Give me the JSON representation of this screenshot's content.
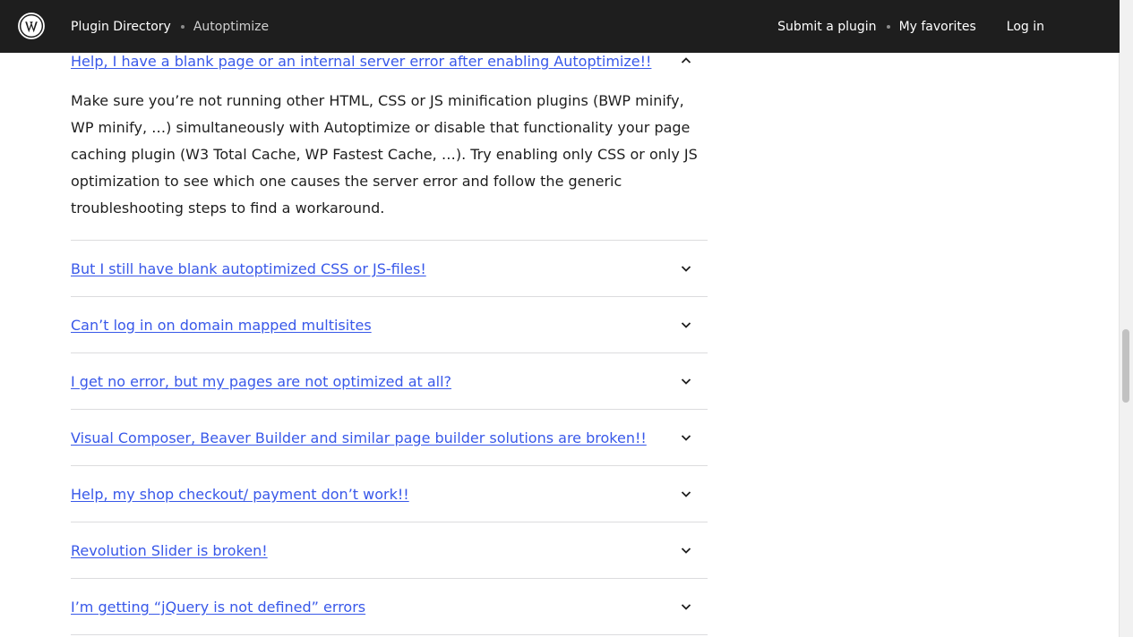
{
  "header": {
    "breadcrumb": [
      "Plugin Directory",
      "Autoptimize"
    ],
    "nav": [
      "Submit a plugin",
      "My favorites",
      "Log in"
    ]
  },
  "faq": {
    "open_item": {
      "question": "Help, I have a blank page or an internal server error after enabling Autoptimize!!",
      "answer": "Make sure you’re not running other HTML, CSS or JS minification plugins (BWP minify, WP minify, …) simultaneously with Autoptimize or disable that functionality your page caching plugin (W3 Total Cache, WP Fastest Cache, …). Try enabling only CSS or only JS optimization to see which one causes the server error and follow the generic troubleshooting steps to find a workaround."
    },
    "items": [
      "But I still have blank autoptimized CSS or JS-files!",
      "Can’t log in on domain mapped multisites",
      "I get no error, but my pages are not optimized at all?",
      "Visual Composer, Beaver Builder and similar page builder solutions are broken!!",
      "Help, my shop checkout/ payment don’t work!!",
      "Revolution Slider is broken!",
      "I’m getting “jQuery is not defined” errors"
    ]
  },
  "icons": {
    "logo": "wordpress-logo-icon",
    "expanded": "chevron-up-icon",
    "collapsed": "chevron-down-icon"
  }
}
